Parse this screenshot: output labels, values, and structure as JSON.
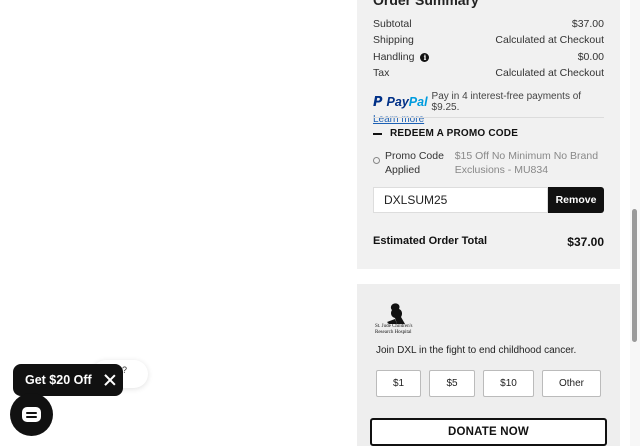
{
  "order_summary": {
    "title": "Order Summary",
    "lines": [
      {
        "label": "Subtotal",
        "value": "$37.00"
      },
      {
        "label": "Shipping",
        "value": "Calculated at Checkout"
      },
      {
        "label": "Handling",
        "value": "$0.00"
      },
      {
        "label": "Tax",
        "value": "Calculated at Checkout"
      }
    ],
    "paypal": {
      "brand_1": "Pay",
      "brand_2": "Pal",
      "message": "Pay in 4 interest-free payments of $9.25.",
      "link": "Learn more"
    },
    "promo": {
      "heading": "REDEEM A PROMO CODE",
      "applied_label": "Promo Code Applied",
      "applied_description": "$15 Off No Minimum No Brand Exclusions - MU834",
      "code_value": "DXLSUM25",
      "remove_label": "Remove"
    },
    "total": {
      "label": "Estimated Order Total",
      "value": "$37.00"
    }
  },
  "donation": {
    "logo_text": "St. Jude Children's Research Hospital",
    "message": "Join DXL in the fight to end childhood cancer.",
    "amounts": [
      "$1",
      "$5",
      "$10",
      "Other"
    ],
    "button_label": "DONATE NOW"
  },
  "floating": {
    "promo_pill": "Get $20 Off",
    "help_bubble_partial": "lp?"
  },
  "icons": {
    "info": "info-icon",
    "close": "close-icon",
    "chat": "chat-icon"
  },
  "colors": {
    "panel_bg": "#f1f1f1",
    "button_dark": "#111111",
    "paypal_dark": "#003087",
    "paypal_light": "#009cde",
    "link": "#1a5fb4"
  }
}
